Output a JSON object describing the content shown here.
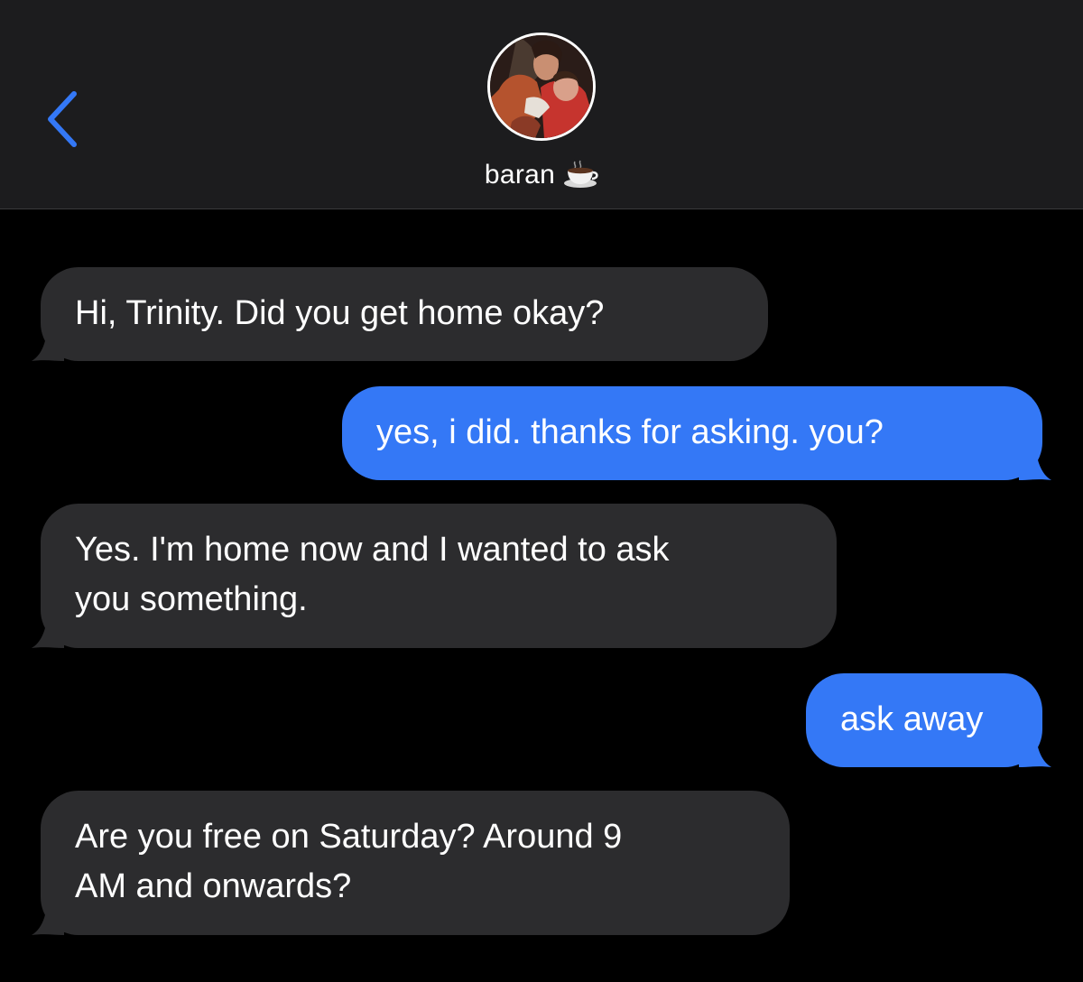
{
  "header": {
    "contact_name": "baran",
    "contact_emoji": "coffee-cup-icon",
    "back_icon": "chevron-left-icon",
    "accent_color": "#3478f6"
  },
  "messages": [
    {
      "direction": "incoming",
      "text": "Hi, Trinity. Did you get home okay?"
    },
    {
      "direction": "outgoing",
      "text": "yes, i did. thanks for asking. you?"
    },
    {
      "direction": "incoming",
      "text": "Yes. I'm home now and I wanted to ask\nyou something."
    },
    {
      "direction": "outgoing",
      "text": "ask away"
    },
    {
      "direction": "incoming",
      "text": "Are you free on Saturday? Around 9\nAM and onwards?"
    }
  ],
  "colors": {
    "incoming_bubble": "#2c2c2e",
    "outgoing_bubble": "#3478f6",
    "background": "#000000",
    "header_background": "#1c1c1e"
  }
}
